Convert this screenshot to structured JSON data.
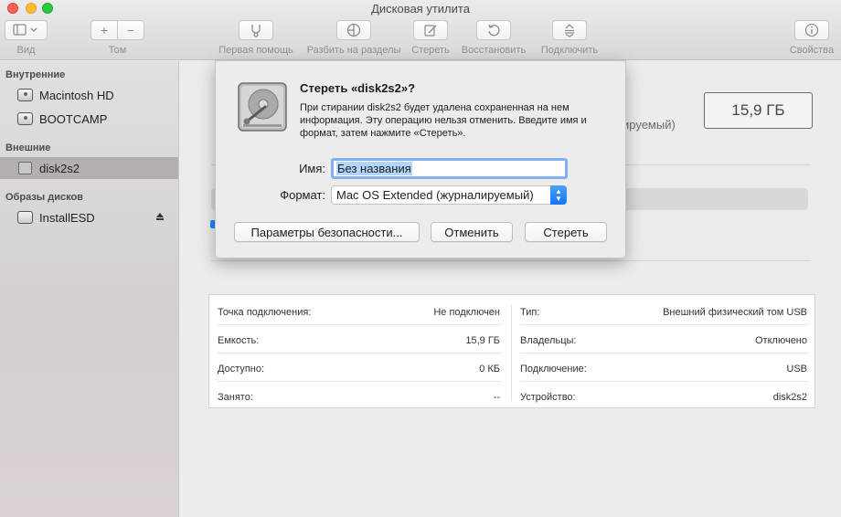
{
  "window": {
    "title": "Дисковая утилита"
  },
  "toolbar": {
    "view_label": "Вид",
    "volume_label": "Том",
    "first_aid_label": "Первая помощь",
    "partition_label": "Разбить на разделы",
    "erase_label": "Стереть",
    "restore_label": "Восстановить",
    "mount_label": "Подключить",
    "info_label": "Свойства",
    "add_symbol": "+",
    "remove_symbol": "−"
  },
  "sidebar": {
    "sections": [
      {
        "title": "Внутренние",
        "items": [
          {
            "label": "Macintosh HD",
            "icon": "hard-disk-icon"
          },
          {
            "label": "BOOTCAMP",
            "icon": "hard-disk-icon"
          }
        ]
      },
      {
        "title": "Внешние",
        "items": [
          {
            "label": "disk2s2",
            "icon": "external-volume-icon",
            "selected": true
          }
        ]
      },
      {
        "title": "Образы дисков",
        "items": [
          {
            "label": "InstallESD",
            "icon": "disk-image-icon",
            "ejectable": true
          }
        ]
      }
    ]
  },
  "main": {
    "size_value": "15,9 ГБ",
    "partial_format_text": "ируемый)",
    "info": {
      "left": [
        {
          "key": "Точка подключения:",
          "value": "Не подключен"
        },
        {
          "key": "Емкость:",
          "value": "15,9 ГБ"
        },
        {
          "key": "Доступно:",
          "value": "0 КБ"
        },
        {
          "key": "Занято:",
          "value": "--"
        }
      ],
      "right": [
        {
          "key": "Тип:",
          "value": "Внешний физический том USB"
        },
        {
          "key": "Владельцы:",
          "value": "Отключено"
        },
        {
          "key": "Подключение:",
          "value": "USB"
        },
        {
          "key": "Устройство:",
          "value": "disk2s2"
        }
      ]
    }
  },
  "dialog": {
    "title": "Стереть «disk2s2»?",
    "message": "При стирании disk2s2 будет удалена сохраненная на нем информация. Эту операцию нельзя отменить. Введите имя и формат, затем нажмите «Стереть».",
    "name_label": "Имя:",
    "name_value": "Без названия",
    "format_label": "Формат:",
    "format_value": "Mac OS Extended (журналируемый)",
    "security_button": "Параметры безопасности...",
    "cancel_button": "Отменить",
    "erase_button": "Стереть"
  },
  "colors": {
    "accent": "#1676f3",
    "selection": "#b3d5fc",
    "sidebar_selected": "#b4aeac"
  }
}
